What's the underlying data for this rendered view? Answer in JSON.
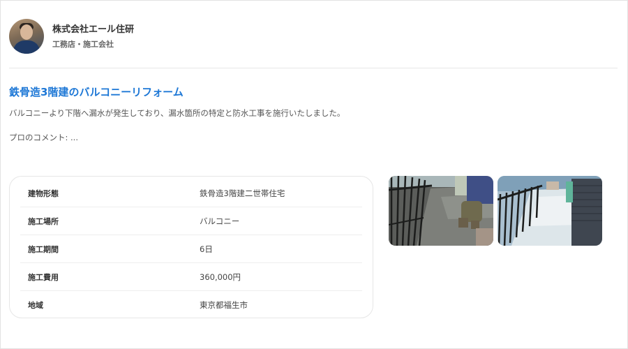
{
  "company": {
    "name": "株式会社エール住研",
    "type": "工務店・施工会社"
  },
  "project": {
    "title": "鉄骨造3階建のバルコニーリフォーム",
    "description": "バルコニーより下階へ漏水が発生しており、漏水箇所の特定と防水工事を施行いたしました。",
    "comment": "プロのコメント: ..."
  },
  "details": [
    {
      "label": "建物形態",
      "value": "鉄骨造3階建二世帯住宅"
    },
    {
      "label": "施工場所",
      "value": "バルコニー"
    },
    {
      "label": "施工期間",
      "value": "6日"
    },
    {
      "label": "施工費用",
      "value": "360,000円"
    },
    {
      "label": "地域",
      "value": "東京都福生市"
    }
  ],
  "colors": {
    "title_link": "#1e78d6",
    "border": "#e6e6e6"
  }
}
